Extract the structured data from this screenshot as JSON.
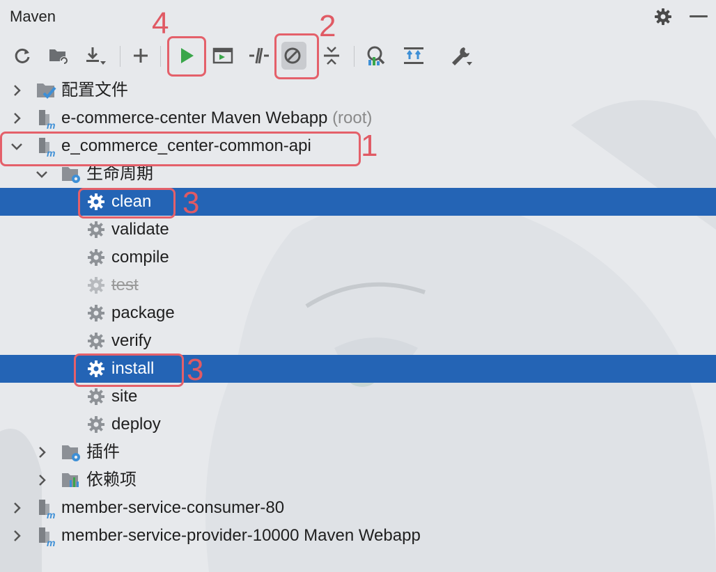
{
  "panel": {
    "title": "Maven"
  },
  "toolbar": {
    "items": [
      {
        "name": "reload-icon",
        "label": "Reload All Maven Projects"
      },
      {
        "name": "generate-sources-icon",
        "label": "Generate Sources"
      },
      {
        "name": "download-icon",
        "label": "Download Sources and Documentation"
      },
      {
        "name": "add-icon",
        "label": "Add Maven Projects"
      },
      {
        "name": "run-icon",
        "label": "Run Maven Build"
      },
      {
        "name": "execute-goal-icon",
        "label": "Execute Maven Goal"
      },
      {
        "name": "toggle-offline-icon",
        "label": "Toggle Offline Mode"
      },
      {
        "name": "skip-tests-icon",
        "label": "Toggle 'Skip Tests' Mode"
      },
      {
        "name": "collapse-all-icon",
        "label": "Collapse All"
      },
      {
        "name": "analyze-deps-icon",
        "label": "Analyze Dependencies"
      },
      {
        "name": "show-deps-icon",
        "label": "Show Dependencies"
      },
      {
        "name": "settings-icon",
        "label": "Build Tool Settings"
      }
    ]
  },
  "tree": {
    "profiles": "配置文件",
    "root_project": {
      "name": "e-commerce-center Maven Webapp",
      "suffix": "(root)"
    },
    "api_project": "e_commerce_center-common-api",
    "lifecycle": {
      "label": "生命周期",
      "goals": [
        "clean",
        "validate",
        "compile",
        "test",
        "package",
        "verify",
        "install",
        "site",
        "deploy"
      ]
    },
    "plugins": "插件",
    "dependencies": "依赖项",
    "consumer_project": "member-service-consumer-80",
    "provider_project": "member-service-provider-10000 Maven Webapp"
  },
  "annotations": {
    "one": "1",
    "two": "2",
    "three_a": "3",
    "three_b": "3",
    "four": "4"
  },
  "colors": {
    "selection": "#2464b5",
    "highlight": "#e4606a",
    "run_green": "#3aa64a",
    "maven_blue": "#3d8fd6"
  }
}
